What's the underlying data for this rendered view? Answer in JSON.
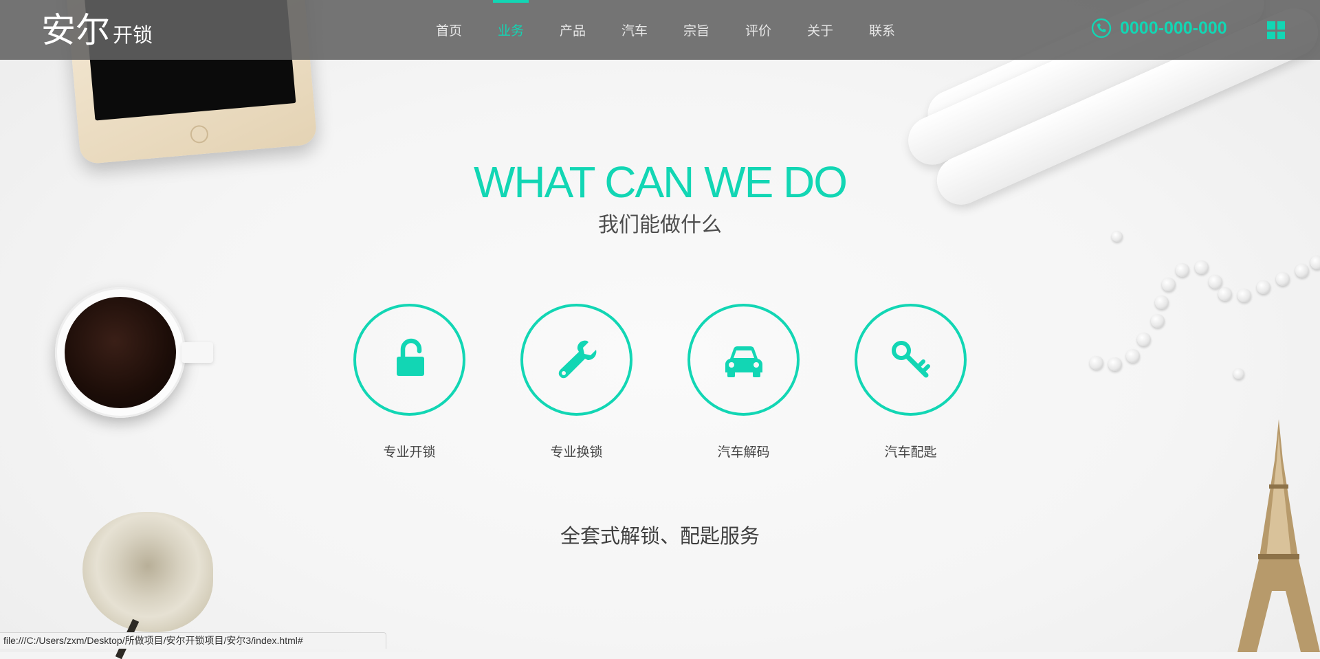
{
  "brand": {
    "main": "安尔",
    "sub": "开锁"
  },
  "nav": {
    "items": [
      {
        "label": "首页",
        "active": false
      },
      {
        "label": "业务",
        "active": true
      },
      {
        "label": "产品",
        "active": false
      },
      {
        "label": "汽车",
        "active": false
      },
      {
        "label": "宗旨",
        "active": false
      },
      {
        "label": "评价",
        "active": false
      },
      {
        "label": "关于",
        "active": false
      },
      {
        "label": "联系",
        "active": false
      }
    ]
  },
  "contact": {
    "phone": "0000-000-000",
    "icon": "phone-icon"
  },
  "header_menu_icon": "grid-menu-icon",
  "hero": {
    "title_en": "WHAT CAN WE DO",
    "title_cn": "我们能做什么"
  },
  "services": [
    {
      "label": "专业开锁",
      "icon": "unlock-icon"
    },
    {
      "label": "专业换锁",
      "icon": "wrench-icon"
    },
    {
      "label": "汽车解码",
      "icon": "car-icon"
    },
    {
      "label": "汽车配匙",
      "icon": "key-icon"
    }
  ],
  "tagline": "全套式解锁、配匙服务",
  "status_url": "file:///C:/Users/zxm/Desktop/所做项目/安尔开锁项目/安尔3/index.html#",
  "colors": {
    "accent": "#12d6b4",
    "header_bg": "#626262",
    "text_dark": "#444444"
  }
}
